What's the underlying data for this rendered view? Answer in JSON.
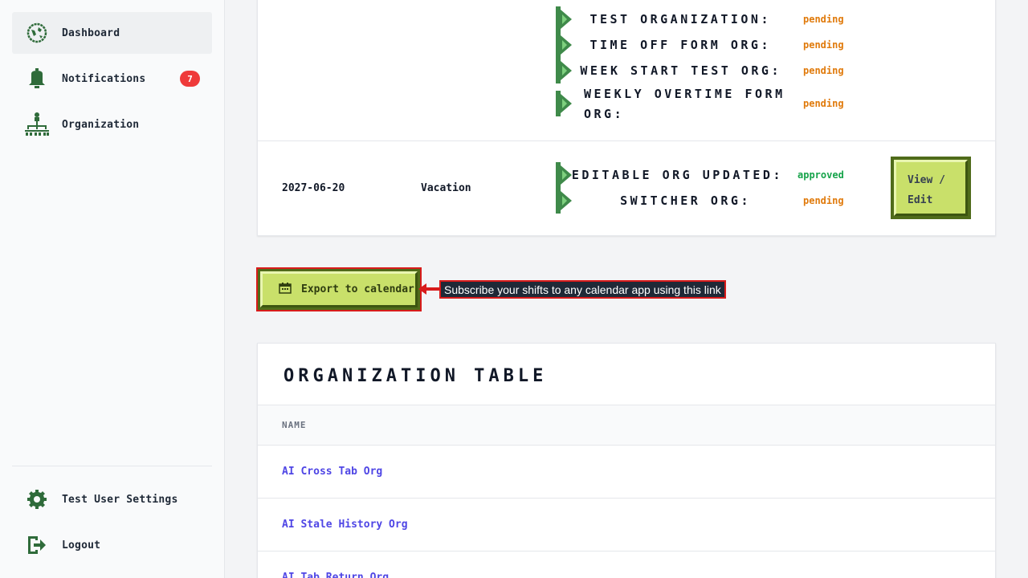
{
  "sidebar": {
    "items": [
      {
        "label": "Dashboard",
        "icon": "dashboard-icon",
        "active": true
      },
      {
        "label": "Notifications",
        "icon": "bell-icon",
        "badge": "7"
      },
      {
        "label": "Organization",
        "icon": "org-chart-icon"
      }
    ],
    "bottom_items": [
      {
        "label": "Test User Settings",
        "icon": "gear-icon"
      },
      {
        "label": "Logout",
        "icon": "logout-icon"
      }
    ]
  },
  "requests": {
    "row1": {
      "orgs": [
        {
          "name": "TEST ORGANIZATION:",
          "status": "pending"
        },
        {
          "name": "TIME OFF FORM ORG:",
          "status": "pending"
        },
        {
          "name": "WEEK START TEST ORG:",
          "status": "pending"
        },
        {
          "name": "WEEKLY OVERTIME FORM ORG:",
          "status": "pending"
        }
      ]
    },
    "row2": {
      "date": "2027-06-20",
      "type": "Vacation",
      "orgs": [
        {
          "name": "EDITABLE ORG UPDATED:",
          "status": "approved"
        },
        {
          "name": "SWITCHER ORG:",
          "status": "pending"
        }
      ],
      "action_label": "View / Edit"
    }
  },
  "export": {
    "label": "Export to calendar",
    "icon": "calendar-icon",
    "tooltip": "Subscribe your shifts to any calendar app using this link"
  },
  "org_table": {
    "title": "ORGANIZATION TABLE",
    "header": "NAME",
    "rows": [
      "AI Cross Tab Org",
      "AI Stale History Org",
      "AI Tab Return Org"
    ]
  },
  "colors": {
    "pending": "#e07a0b",
    "approved": "#16a34a",
    "accent_green": "#4f6b1a",
    "button_fill": "#c9e06a",
    "badge": "#ef3a3a",
    "link": "#4f46e5"
  }
}
